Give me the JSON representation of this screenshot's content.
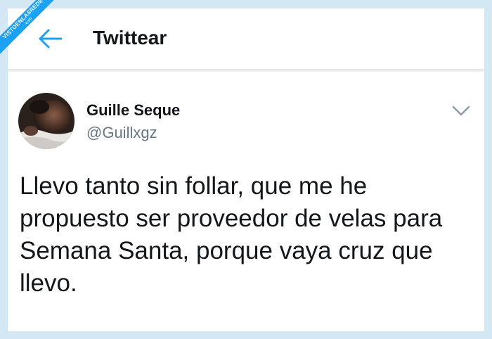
{
  "watermark": {
    "text": "VISTOENLASREDES",
    "suffix": ".com"
  },
  "header": {
    "back_icon": "arrow-left-icon",
    "title": "Twittear"
  },
  "tweet": {
    "author_name": "Guille Seque",
    "author_handle": "@Guillxgz",
    "menu_icon": "chevron-down-icon",
    "text": "Llevo tanto sin follar, que me he propuesto ser proveedor de velas para Semana Santa, porque vaya cruz que llevo."
  },
  "colors": {
    "accent": "#1da1f2",
    "text_primary": "#14171a",
    "text_secondary": "#657786",
    "background": "#d3e7f5"
  }
}
